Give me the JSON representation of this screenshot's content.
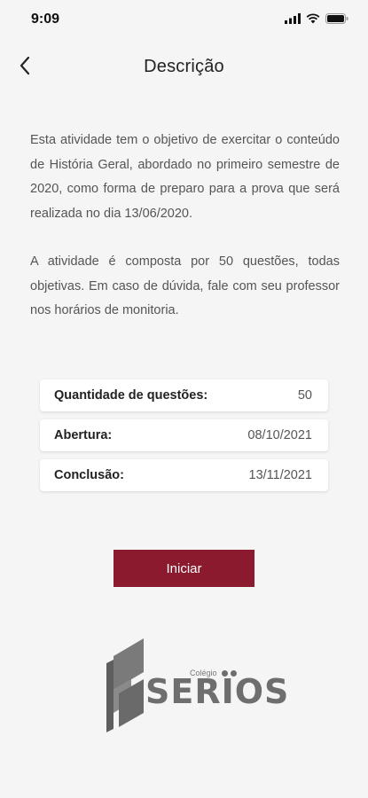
{
  "status_bar": {
    "time": "9:09"
  },
  "header": {
    "title": "Descrição"
  },
  "description": {
    "paragraphs": [
      "Esta atividade tem o objetivo de exercitar o conteúdo de História Geral, abordado no primeiro semestre de 2020, como forma de preparo para a prova que será realizada no dia 13/06/2020.",
      "A atividade é composta por 50 questões, todas objetivas. Em caso de dúvida, fale com seu professor nos horários de monitoria."
    ]
  },
  "info": [
    {
      "label": "Quantidade de questões:",
      "value": "50"
    },
    {
      "label": "Abertura:",
      "value": "08/10/2021"
    },
    {
      "label": "Conclusão:",
      "value": "13/11/2021"
    }
  ],
  "start_button": {
    "label": "Iniciar"
  },
  "logo": {
    "sub": "Colégio",
    "word": "SERIOS"
  },
  "colors": {
    "accent": "#8b1a2e",
    "background": "#f5f5f5",
    "logo_gray": "#6e6e6e"
  }
}
